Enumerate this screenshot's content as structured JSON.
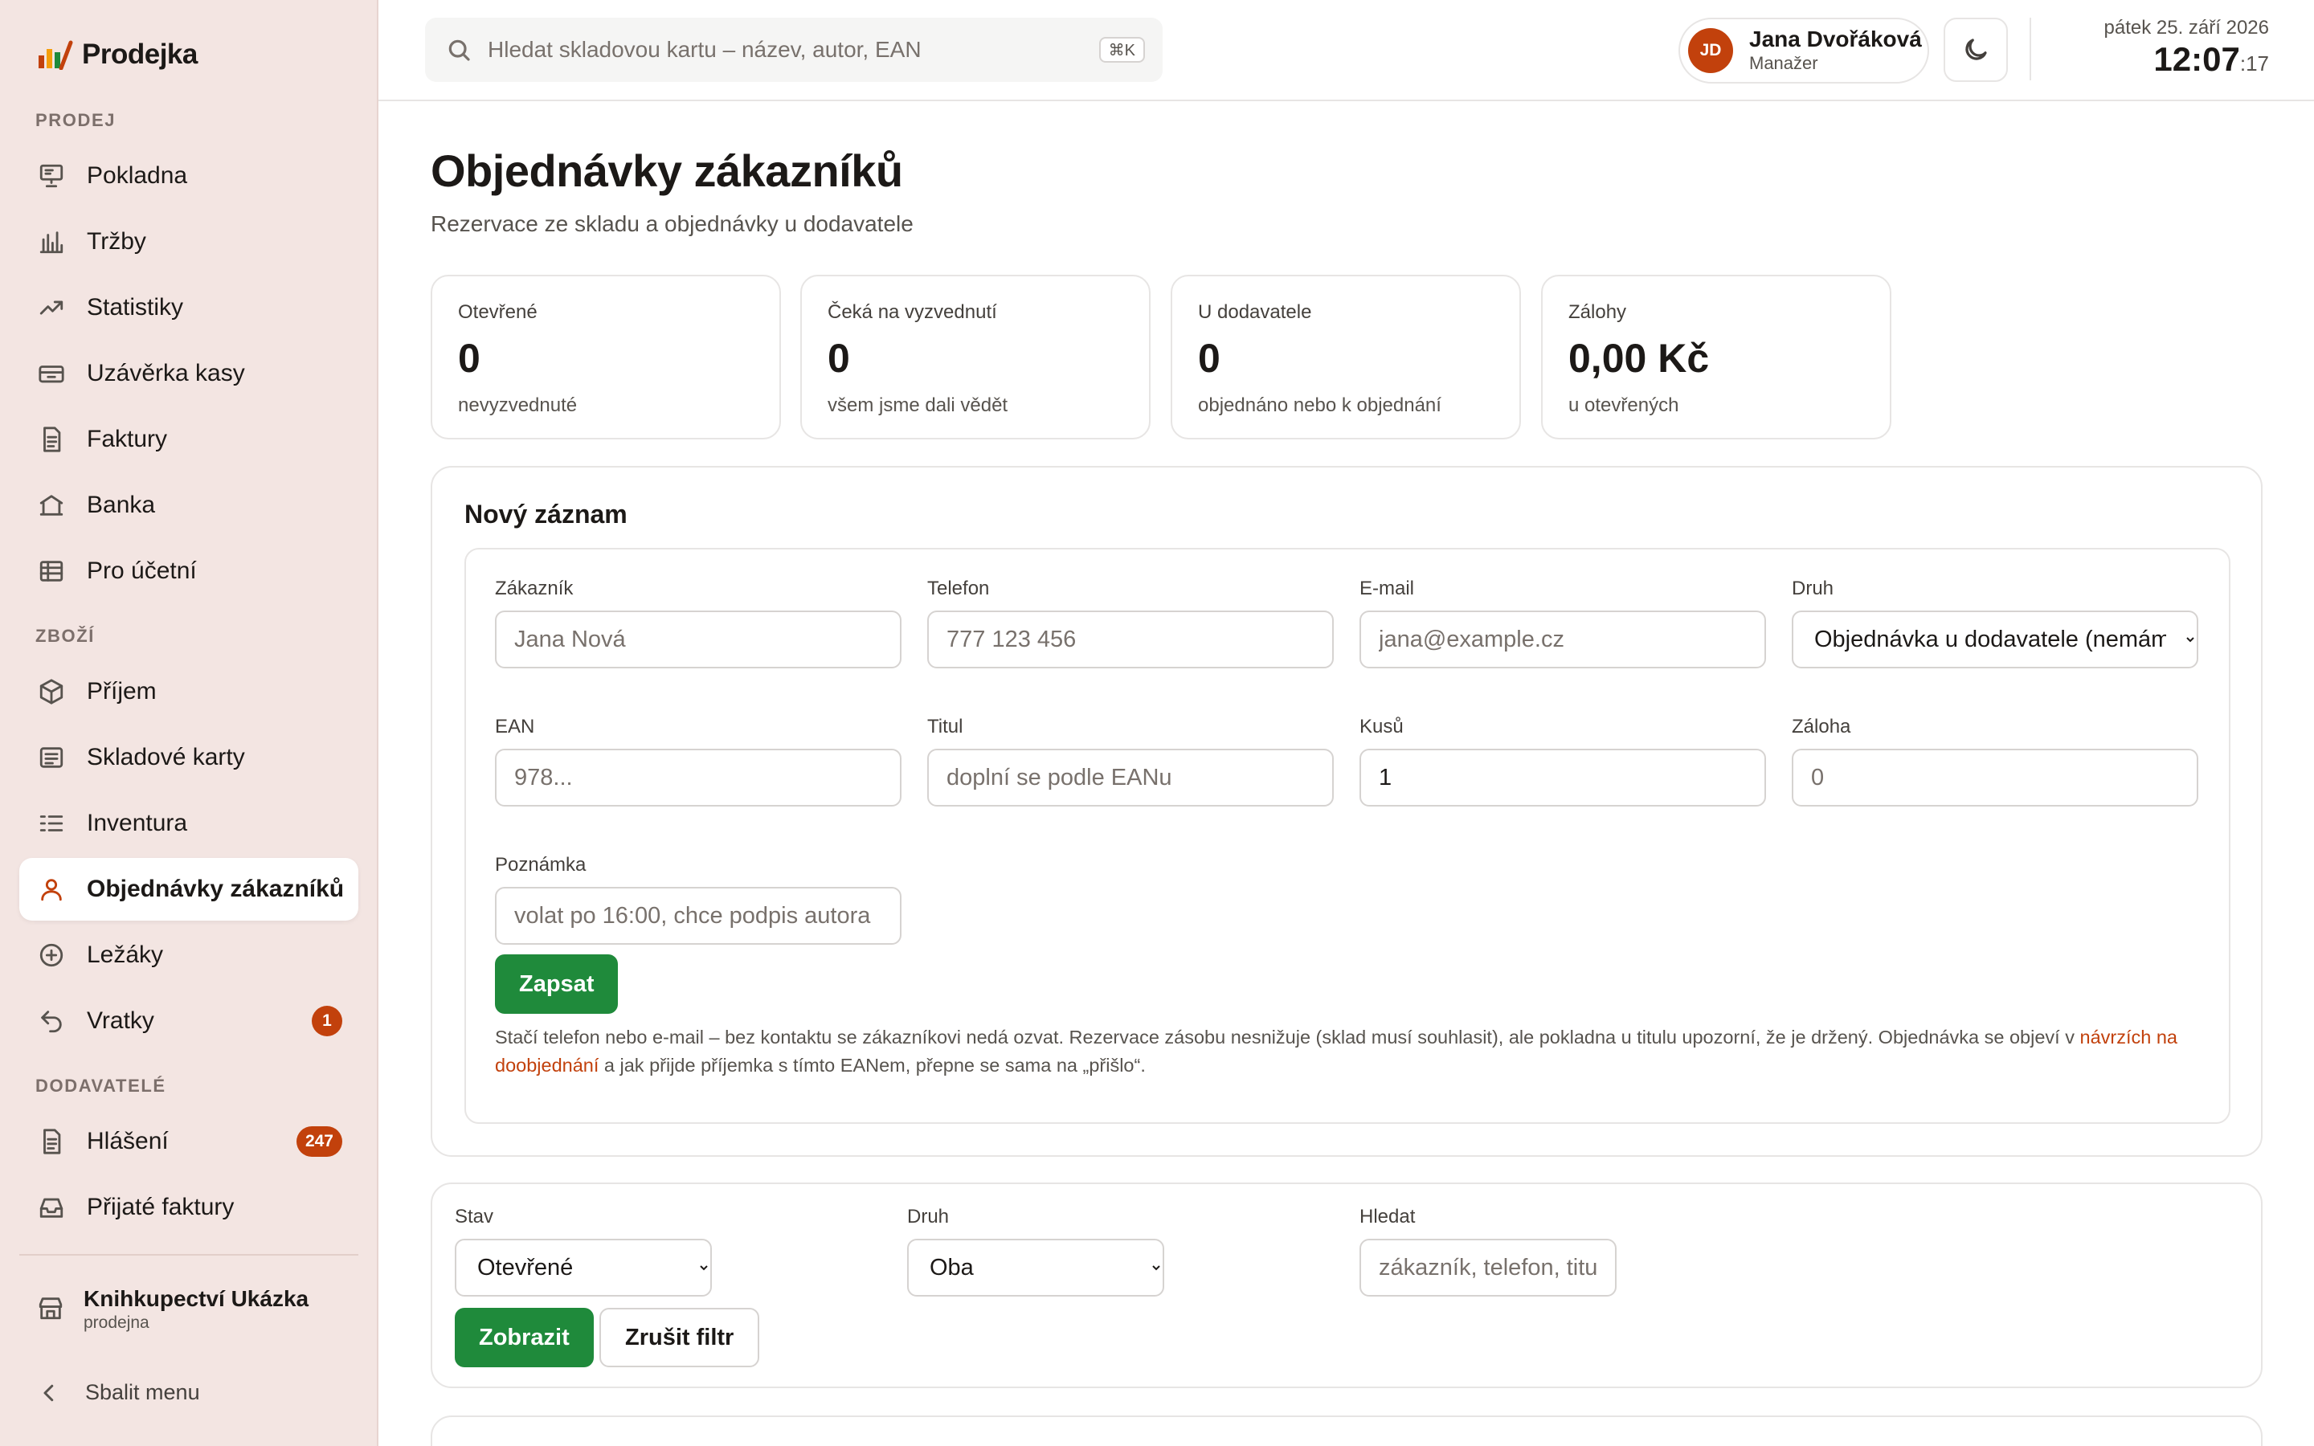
{
  "app": {
    "name": "Prodejka"
  },
  "sidebar": {
    "sections": {
      "sales": "PRODEJ",
      "goods": "ZBOŽÍ",
      "suppliers": "DODAVATELÉ"
    },
    "items": [
      {
        "label": "Pokladna",
        "icon": "cash-register-icon"
      },
      {
        "label": "Tržby",
        "icon": "bar-chart-icon"
      },
      {
        "label": "Statistiky",
        "icon": "trend-icon"
      },
      {
        "label": "Uzávěrka kasy",
        "icon": "cash-drawer-icon"
      },
      {
        "label": "Faktury",
        "icon": "document-icon"
      },
      {
        "label": "Banka",
        "icon": "bank-icon"
      },
      {
        "label": "Pro účetní",
        "icon": "table-icon"
      },
      {
        "label": "Příjem",
        "icon": "box-icon"
      },
      {
        "label": "Skladové karty",
        "icon": "card-list-icon"
      },
      {
        "label": "Inventura",
        "icon": "checklist-icon"
      },
      {
        "label": "Objednávky zákazníků",
        "icon": "user-icon",
        "active": true
      },
      {
        "label": "Ležáky",
        "icon": "plus-circle-icon"
      },
      {
        "label": "Vratky",
        "icon": "return-icon",
        "badge": "1"
      },
      {
        "label": "Hlášení",
        "icon": "document-icon",
        "badge": "247"
      },
      {
        "label": "Přijaté faktury",
        "icon": "inbox-icon"
      }
    ],
    "store": {
      "name": "Knihkupectví Ukázka",
      "type": "prodejna"
    },
    "collapse_label": "Sbalit menu"
  },
  "topbar": {
    "search_placeholder": "Hledat skladovou kartu – název, autor, EAN",
    "search_shortcut": "⌘K",
    "user": {
      "initials": "JD",
      "name": "Jana Dvořáková",
      "role": "Manažer"
    },
    "date": "pátek 25. září 2026",
    "time": "12:07",
    "seconds": ":17"
  },
  "page": {
    "title": "Objednávky zákazníků",
    "subtitle": "Rezervace ze skladu a objednávky u dodavatele"
  },
  "stats": [
    {
      "label": "Otevřené",
      "value": "0",
      "hint": "nevyzvednuté"
    },
    {
      "label": "Čeká na vyzvednutí",
      "value": "0",
      "hint": "všem jsme dali vědět"
    },
    {
      "label": "U dodavatele",
      "value": "0",
      "hint": "objednáno nebo k objednání"
    },
    {
      "label": "Zálohy",
      "value": "0,00 Kč",
      "hint": "u otevřených"
    }
  ],
  "new_record": {
    "title": "Nový záznam",
    "fields": {
      "customer": {
        "label": "Zákazník",
        "placeholder": "Jana Nová",
        "value": ""
      },
      "phone": {
        "label": "Telefon",
        "placeholder": "777 123 456",
        "value": ""
      },
      "email": {
        "label": "E-mail",
        "placeholder": "jana@example.cz",
        "value": ""
      },
      "kind": {
        "label": "Druh",
        "selected": "Objednávka u dodavatele (nemáme skladem)"
      },
      "ean": {
        "label": "EAN",
        "placeholder": "978...",
        "value": ""
      },
      "title": {
        "label": "Titul",
        "placeholder": "doplní se podle EANu",
        "value": ""
      },
      "qty": {
        "label": "Kusů",
        "value": "1"
      },
      "deposit": {
        "label": "Záloha",
        "placeholder": "0",
        "value": ""
      },
      "note": {
        "label": "Poznámka",
        "placeholder": "volat po 16:00, chce podpis autora",
        "value": ""
      }
    },
    "submit_label": "Zapsat",
    "help_part1": "Stačí telefon nebo e-mail – bez kontaktu se zákazníkovi nedá ozvat. Rezervace zásobu nesnižuje (sklad musí souhlasit), ale pokladna u titulu upozorní, že je držený. Objednávka se objeví v ",
    "help_link": "návrzích na doobjednání",
    "help_part2": " a jak přijde příjemka s tímto EANem, přepne se sama na „přišlo“."
  },
  "filter": {
    "status": {
      "label": "Stav",
      "selected": "Otevřené"
    },
    "kind": {
      "label": "Druh",
      "selected": "Oba"
    },
    "search": {
      "label": "Hledat",
      "placeholder": "zákazník, telefon, titul"
    },
    "show_label": "Zobrazit",
    "reset_label": "Zrušit filtr"
  },
  "colors": {
    "accent": "#c2410c",
    "primary_button": "#1f8a3b",
    "sidebar_bg": "#f3e5e2"
  }
}
